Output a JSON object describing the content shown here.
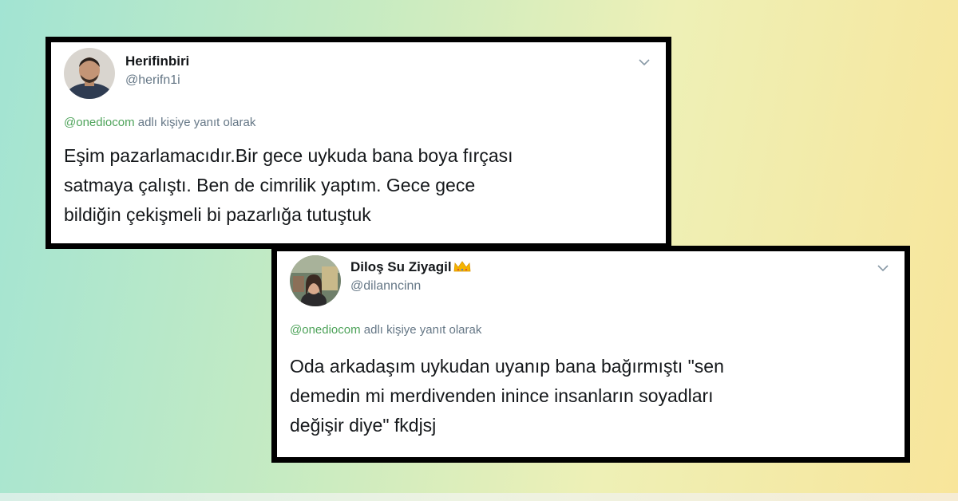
{
  "tweets": [
    {
      "display_name": "Herifinbiri",
      "handle": "@herifn1i",
      "reply_mention": "@onediocom",
      "reply_suffix": " adlı kişiye yanıt olarak",
      "text_lines": [
        "Eşim pazarlamacıdır.Bir gece uykuda bana boya fırçası",
        "satmaya çalıştı. Ben de cimrilik yaptım. Gece gece",
        "bildiğin çekişmeli bi pazarlığa tutuştuk"
      ]
    },
    {
      "display_name": "Diloş Su Ziyagil",
      "handle": "@dilanncinn",
      "badge_icon": "crown-icon",
      "reply_mention": "@onediocom",
      "reply_suffix": " adlı kişiye yanıt olarak",
      "text_lines": [
        "Oda arkadaşım uykudan uyanıp bana bağırmıştı \"sen",
        "demedin mi merdivenden inince insanların soyadları",
        "değişir diye\" fkdjsj"
      ]
    }
  ],
  "icons": {
    "chevron": "chevron-down-icon"
  },
  "colors": {
    "mention": "#4ea35a",
    "secondary_text": "#657786",
    "primary_text": "#14171a",
    "card_border": "#000000",
    "crown": "#f5b400"
  }
}
